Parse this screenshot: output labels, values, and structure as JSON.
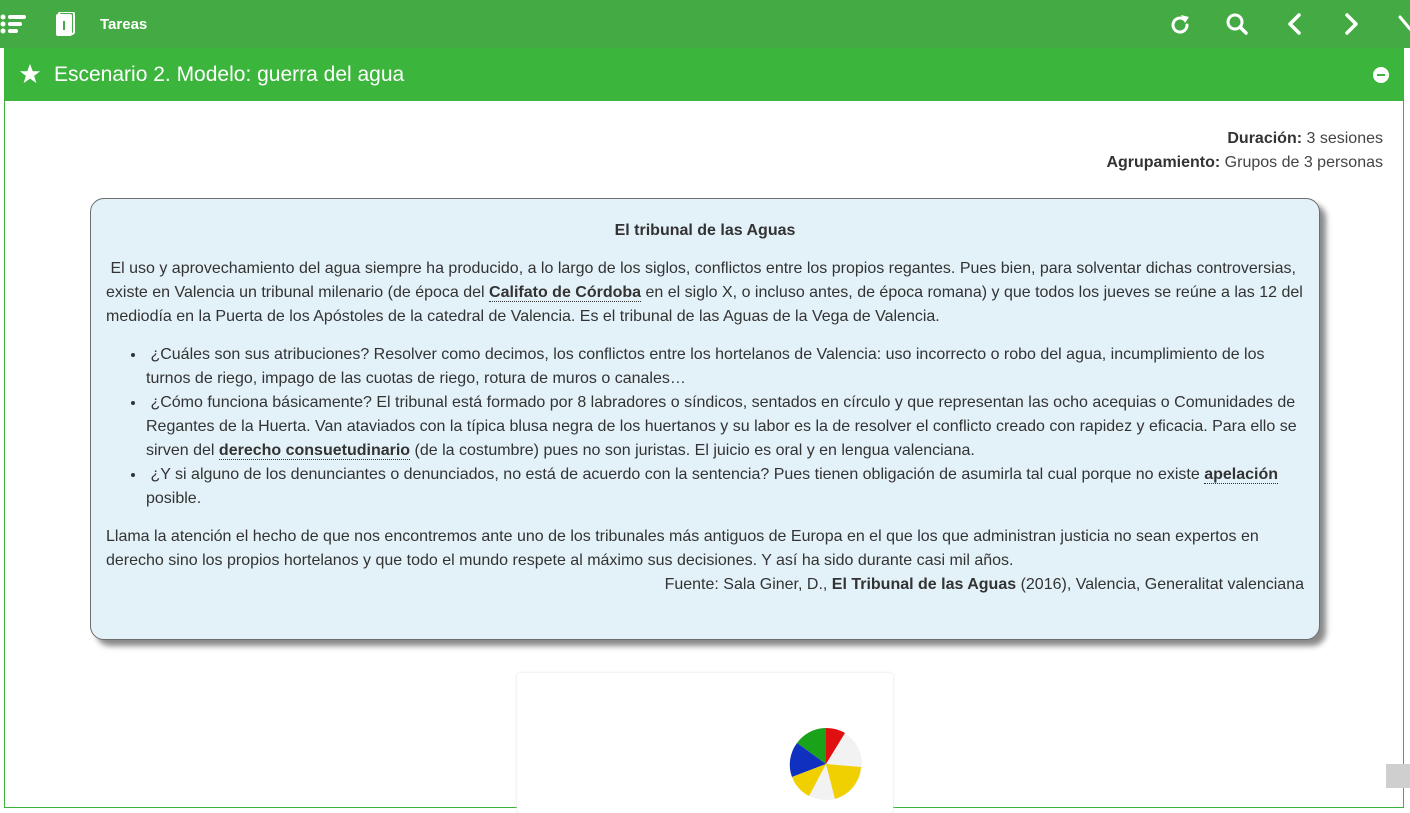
{
  "topbar": {
    "title": "Tareas",
    "icons": [
      "menu-icon",
      "book-icon",
      "refresh-icon",
      "search-icon",
      "chevron-left-icon",
      "chevron-right-icon",
      "close-icon"
    ]
  },
  "panel": {
    "title": "Escenario 2. Modelo: guerra del agua",
    "meta": {
      "duration_label": "Duración:",
      "duration_value": "3 sesiones",
      "grouping_label": "Agrupamiento:",
      "grouping_value": "Grupos de 3 personas"
    }
  },
  "infobox": {
    "heading": "El tribunal de las Aguas",
    "intro_part1": " El uso y aprovechamiento del agua siempre ha producido, a lo largo de los siglos, conflictos entre los propios regantes. Pues bien, para solventar dichas controversias, existe en Valencia un tribunal milenario (de época del ",
    "intro_term": "Califato de Córdoba",
    "intro_part2": " en el siglo X, o incluso antes, de época romana) y que todos los jueves se reúne a las 12 del mediodía en la Puerta de los Apóstoles de la catedral de Valencia. Es el tribunal de las Aguas de la Vega de Valencia.",
    "bullet1": " ¿Cuáles son sus atribuciones? Resolver como decimos, los conflictos entre los hortelanos de Valencia: uso incorrecto o robo del agua, incumplimiento de los turnos de riego, impago de las cuotas de riego, rotura de muros o canales…",
    "bullet2_part1": " ¿Cómo funciona básicamente? El tribunal está formado por 8 labradores o síndicos, sentados en círculo y que representan las ocho acequias o Comunidades de Regantes de la Huerta. Van ataviados con la típica blusa negra de los huertanos y su labor es la de resolver el conflicto creado con rapidez y eficacia. Para ello se sirven del ",
    "bullet2_term": "derecho consuetudinario",
    "bullet2_part2": " (de la costumbre) pues no son juristas. El juicio es oral y en lengua valenciana.",
    "bullet3_part1": " ¿Y si alguno de los denunciantes o denunciados, no está de acuerdo con la sentencia? Pues tienen obligación de asumirla tal cual porque no existe ",
    "bullet3_term": "apelación",
    "bullet3_part2": " posible.",
    "closing": "Llama la atención el hecho de que nos encontremos ante uno de los tribunales más antiguos de Europa en el que los que administran justicia no sean expertos en derecho sino  los propios hortelanos y que todo el mundo respete al máximo sus decisiones. Y así ha sido durante casi mil años.",
    "source_prefix": "Fuente: Sala Giner, D., ",
    "source_title": "El Tribunal de las Aguas",
    "source_suffix": " (2016), Valencia, Generalitat valenciana"
  }
}
